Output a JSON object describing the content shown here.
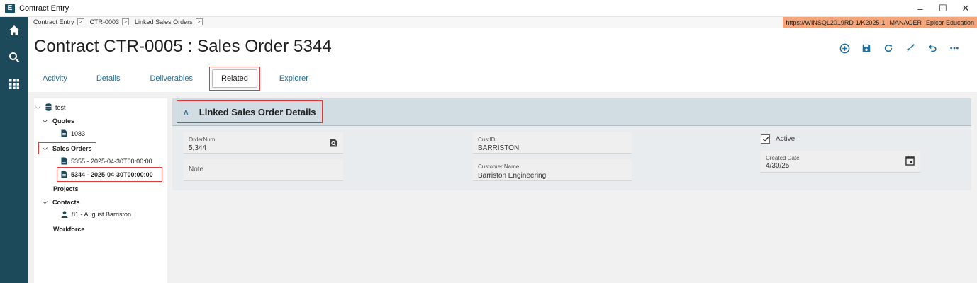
{
  "window": {
    "title": "Contract Entry",
    "minimize": "–",
    "maximize": "☐",
    "close": "✕"
  },
  "rail": {
    "items": [
      {
        "icon": "home-icon"
      },
      {
        "icon": "search-icon"
      },
      {
        "icon": "apps-grid-icon"
      }
    ]
  },
  "breadcrumb": {
    "items": [
      "Contract Entry",
      "CTR-0003",
      "Linked Sales Orders"
    ],
    "sep": ">"
  },
  "environment": {
    "url": "https://WINSQL2019RD-1/K2025-1",
    "role": "MANAGER",
    "company": "Epicor Education"
  },
  "page": {
    "title": "Contract CTR-0005 : Sales Order 5344"
  },
  "toolbar": {
    "icons": [
      "add-icon",
      "save-icon",
      "refresh-icon",
      "clear-icon",
      "undo-icon",
      "more-icon"
    ]
  },
  "tabs": {
    "activity": "Activity",
    "details": "Details",
    "deliverables": "Deliverables",
    "related": "Related",
    "explorer": "Explorer",
    "active": "Related"
  },
  "tree": {
    "root": "test",
    "quotes": "Quotes",
    "quote_1": "1083",
    "sales_orders": "Sales Orders",
    "so_1": "5355 - 2025-04-30T00:00:00",
    "so_2": "5344 - 2025-04-30T00:00:00",
    "projects": "Projects",
    "contacts": "Contacts",
    "contact_1": "81 - August Barriston",
    "workforce": "Workforce"
  },
  "panel": {
    "title": "Linked Sales Order Details",
    "order_num_label": "OrderNum",
    "order_num_value": "5,344",
    "note_placeholder": "Note",
    "cust_id_label": "CustID",
    "cust_id_value": "BARRISTON",
    "customer_name_label": "Customer Name",
    "customer_name_value": "Barriston Engineering",
    "active_label": "Active",
    "active_checked": true,
    "created_date_label": "Created Date",
    "created_date_value": "4/30/25"
  },
  "colors": {
    "rail": "#1c4a5a",
    "accent": "#1f6e9a",
    "highlight_border": "#e53935",
    "env_bar": "#f4a67a"
  }
}
